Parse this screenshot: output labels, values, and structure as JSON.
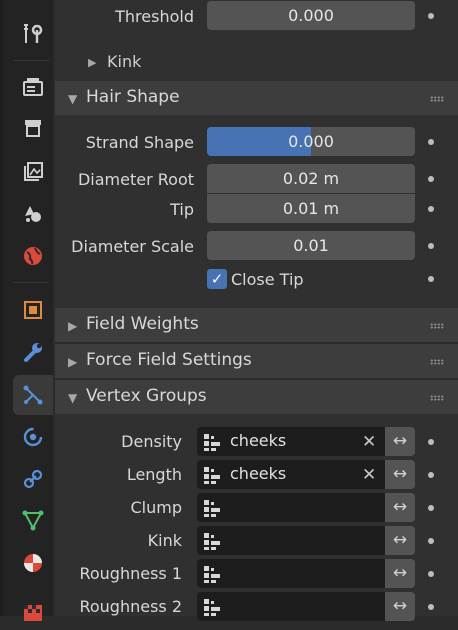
{
  "threshold": {
    "label": "Threshold",
    "value": "0.000"
  },
  "kink": {
    "label": "Kink"
  },
  "hair_shape": {
    "title": "Hair Shape",
    "strand_shape": {
      "label": "Strand Shape",
      "value": "0.000",
      "fill_fraction": 0.5
    },
    "diameter_root": {
      "label": "Diameter Root",
      "value": "0.02 m"
    },
    "tip": {
      "label": "Tip",
      "value": "0.01 m"
    },
    "diameter_scale": {
      "label": "Diameter Scale",
      "value": "0.01"
    },
    "close_tip": {
      "label": "Close Tip",
      "checked": true
    }
  },
  "field_weights": {
    "title": "Field Weights"
  },
  "force_field_settings": {
    "title": "Force Field Settings"
  },
  "vertex_groups": {
    "title": "Vertex Groups",
    "rows": [
      {
        "label": "Density",
        "group": "cheeks"
      },
      {
        "label": "Length",
        "group": "cheeks"
      },
      {
        "label": "Clump",
        "group": ""
      },
      {
        "label": "Kink",
        "group": ""
      },
      {
        "label": "Roughness 1",
        "group": ""
      },
      {
        "label": "Roughness 2",
        "group": ""
      }
    ]
  },
  "colors": {
    "accent": "#4772b3",
    "panel": "#303030",
    "header": "#3d3d3d",
    "field": "#545454"
  }
}
